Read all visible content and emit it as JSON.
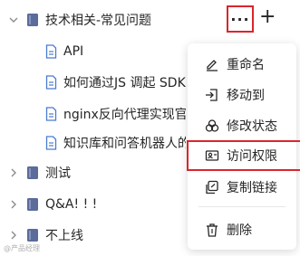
{
  "tree": {
    "group": {
      "label": "技术相关-常见问题",
      "expanded": true,
      "children": [
        {
          "label": "API"
        },
        {
          "label": "如何通过JS 调起 SDK"
        },
        {
          "label": "nginx反向代理实现官网"
        },
        {
          "label": "知识库和问答机器人的"
        }
      ]
    },
    "others": [
      {
        "label": "测试"
      },
      {
        "label": "Q&A! ! !"
      },
      {
        "label": "不上线"
      }
    ]
  },
  "actions": {
    "more": "···",
    "add": "+"
  },
  "context_menu": {
    "items": [
      {
        "label": "重命名",
        "icon": "edit-icon"
      },
      {
        "label": "移动到",
        "icon": "move-icon"
      },
      {
        "label": "修改状态",
        "icon": "status-icon"
      },
      {
        "label": "访问权限",
        "icon": "permission-icon",
        "highlighted": true
      },
      {
        "label": "复制链接",
        "icon": "copy-link-icon"
      },
      {
        "label": "删除",
        "icon": "trash-icon"
      }
    ]
  },
  "watermark": "@产品经理",
  "colors": {
    "highlight_border": "#d9262c",
    "book_icon": "#5b6b9a",
    "doc_icon": "#4a7bd0"
  }
}
